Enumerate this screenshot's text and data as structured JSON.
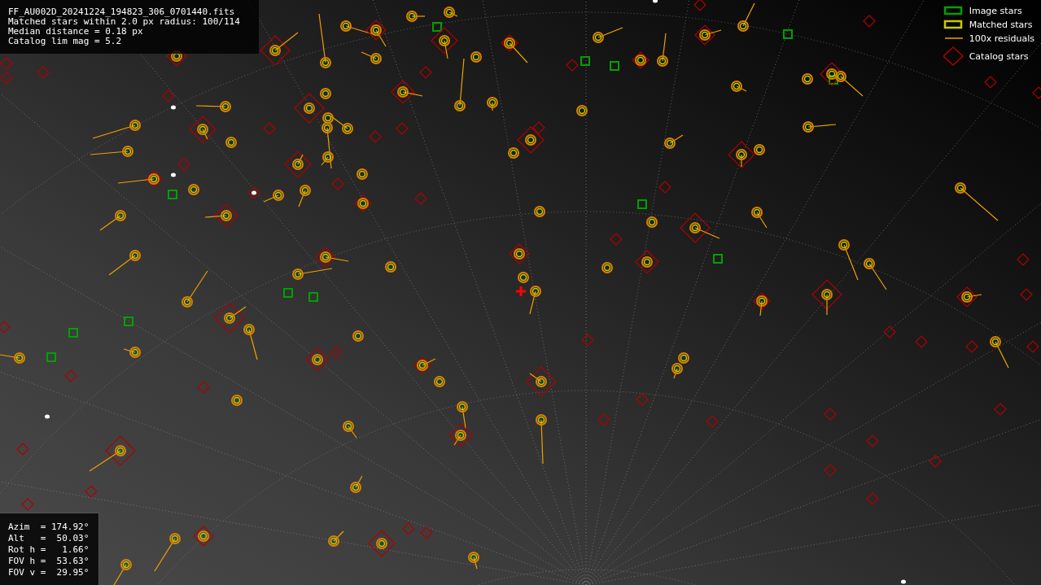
{
  "info": {
    "lines": [
      "FF_AU002D_20241224_194823_306_0701440.fits",
      "Matched stars within 2.0 px radius: 100/114",
      "Median distance = 0.18 px",
      "Catalog lim mag = 5.2"
    ]
  },
  "legend": [
    {
      "kind": "image",
      "label": "Image stars"
    },
    {
      "kind": "matched",
      "label": "Matched stars"
    },
    {
      "kind": "residual",
      "label": "100x residuals"
    },
    {
      "kind": "catalog",
      "label": "Catalog stars"
    }
  ],
  "pointing": {
    "lines": [
      "Azim  = 174.92°",
      "Alt   =  50.03°",
      "Rot h =   1.66°",
      "FOV h =  53.63°",
      "FOV v =  29.95°"
    ]
  }
}
